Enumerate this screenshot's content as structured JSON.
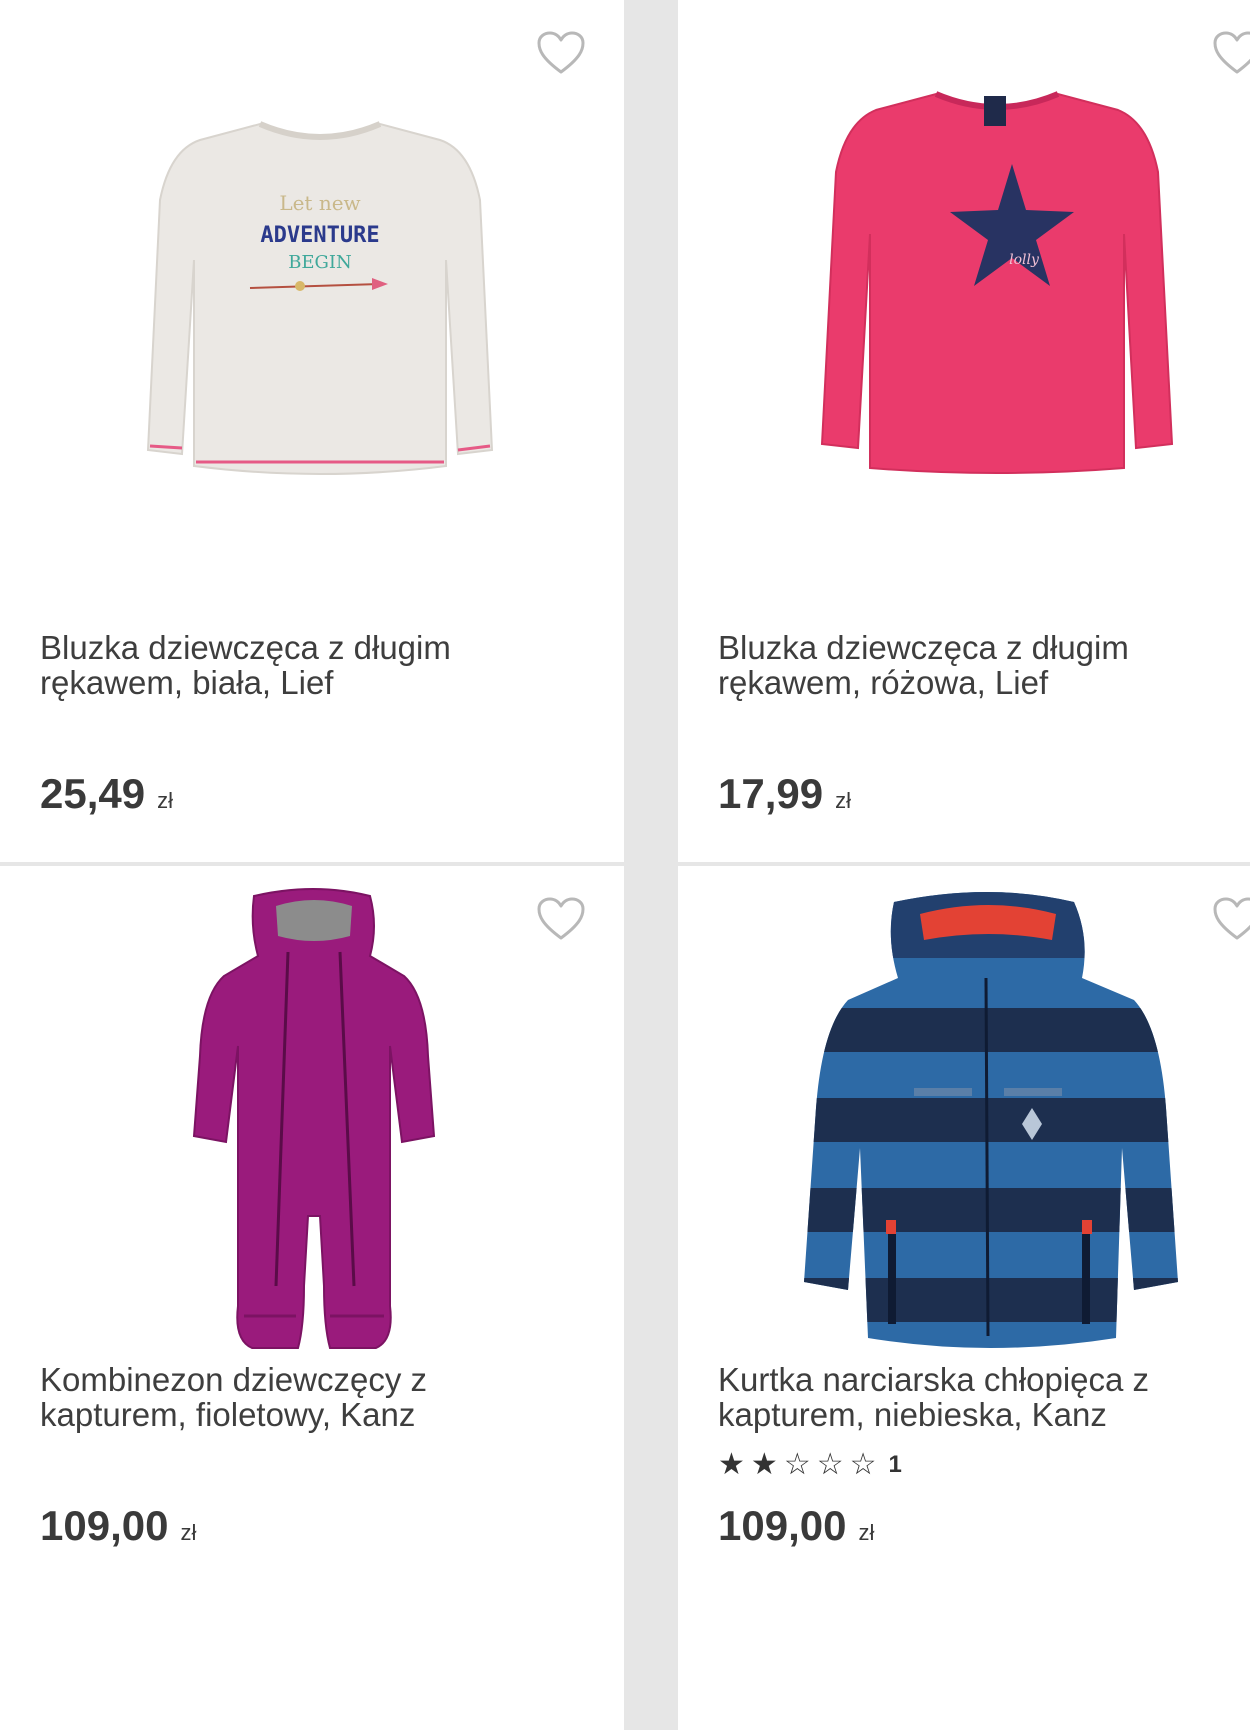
{
  "products": [
    {
      "title_line1": "Bluzka dziewczęca z długim",
      "title_line2": "rękawem, biała, Lief",
      "price": "25,49",
      "currency": "zł",
      "print_lines": [
        "Let new",
        "ADVENTURE",
        "BEGIN"
      ]
    },
    {
      "title_line1": "Bluzka dziewczęca z długim",
      "title_line2": "rękawem, różowa, Lief",
      "price": "17,99",
      "currency": "zł",
      "print_text": "lolly"
    },
    {
      "title_line1": "Kombinezon dziewczęcy z",
      "title_line2": "kapturem, fioletowy, Kanz",
      "price": "109,00",
      "currency": "zł"
    },
    {
      "title_line1": "Kurtka narciarska chłopięca z",
      "title_line2": "kapturem, niebieska, Kanz",
      "price": "109,00",
      "currency": "zł",
      "rating": 2,
      "rating_max": 5,
      "rating_count": "1"
    }
  ],
  "icons": {
    "favorite": "heart-outline-icon",
    "star_filled": "star-filled-icon",
    "star_empty": "star-outline-icon"
  },
  "colors": {
    "card_bg": "#ffffff",
    "grid_bg": "#e6e6e6",
    "text": "#3a3a3a",
    "heart": "#b8b8b8",
    "shirt_white": "#ebe8e4",
    "shirt_pink": "#ea3b6c",
    "suit_purple": "#9a1b7c",
    "jacket_blue": "#2d6aa6",
    "jacket_navy": "#1d2f4f"
  }
}
